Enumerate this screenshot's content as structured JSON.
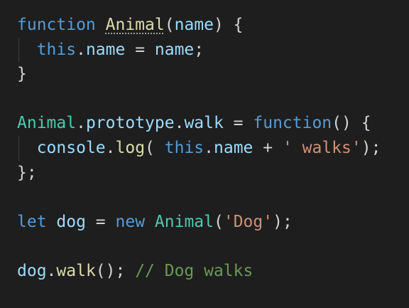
{
  "theme": {
    "background": "#1e1e1e",
    "keyword": "#569cd6",
    "function": "#dcdcaa",
    "class": "#4ec9b0",
    "variable": "#9cdcfe",
    "string": "#ce9178",
    "punctuation": "#d4d4d4",
    "comment": "#6a9955"
  },
  "lines": [
    [
      {
        "t": "function",
        "c": "keyword"
      },
      {
        "t": " ",
        "c": "punct"
      },
      {
        "t": "Animal",
        "c": "func",
        "squiggle": true
      },
      {
        "t": "(",
        "c": "punct"
      },
      {
        "t": "name",
        "c": "var"
      },
      {
        "t": ") {",
        "c": "punct"
      }
    ],
    [
      {
        "t": "  ",
        "c": "punct"
      },
      {
        "t": "this",
        "c": "keyword"
      },
      {
        "t": ".",
        "c": "punct"
      },
      {
        "t": "name",
        "c": "prop"
      },
      {
        "t": " = ",
        "c": "punct"
      },
      {
        "t": "name",
        "c": "var"
      },
      {
        "t": ";",
        "c": "punct"
      }
    ],
    [
      {
        "t": "}",
        "c": "punct"
      }
    ],
    [],
    [
      {
        "t": "Animal",
        "c": "class"
      },
      {
        "t": ".",
        "c": "punct"
      },
      {
        "t": "prototype",
        "c": "prop"
      },
      {
        "t": ".",
        "c": "punct"
      },
      {
        "t": "walk",
        "c": "prop"
      },
      {
        "t": " = ",
        "c": "punct"
      },
      {
        "t": "function",
        "c": "keyword"
      },
      {
        "t": "() {",
        "c": "punct"
      }
    ],
    [
      {
        "t": "  ",
        "c": "punct"
      },
      {
        "t": "console",
        "c": "var"
      },
      {
        "t": ".",
        "c": "punct"
      },
      {
        "t": "log",
        "c": "func"
      },
      {
        "t": "( ",
        "c": "punct"
      },
      {
        "t": "this",
        "c": "keyword"
      },
      {
        "t": ".",
        "c": "punct"
      },
      {
        "t": "name",
        "c": "prop"
      },
      {
        "t": " + ",
        "c": "punct"
      },
      {
        "t": "' walks'",
        "c": "string"
      },
      {
        "t": ");",
        "c": "punct"
      }
    ],
    [
      {
        "t": "};",
        "c": "punct"
      }
    ],
    [],
    [
      {
        "t": "let",
        "c": "keyword"
      },
      {
        "t": " ",
        "c": "punct"
      },
      {
        "t": "dog",
        "c": "var"
      },
      {
        "t": " = ",
        "c": "punct"
      },
      {
        "t": "new",
        "c": "keyword"
      },
      {
        "t": " ",
        "c": "punct"
      },
      {
        "t": "Animal",
        "c": "class"
      },
      {
        "t": "(",
        "c": "punct"
      },
      {
        "t": "'Dog'",
        "c": "string"
      },
      {
        "t": ");",
        "c": "punct"
      }
    ],
    [],
    [
      {
        "t": "dog",
        "c": "var"
      },
      {
        "t": ".",
        "c": "punct"
      },
      {
        "t": "walk",
        "c": "func"
      },
      {
        "t": "(); ",
        "c": "punct"
      },
      {
        "t": "// Dog walks",
        "c": "comment"
      }
    ]
  ]
}
